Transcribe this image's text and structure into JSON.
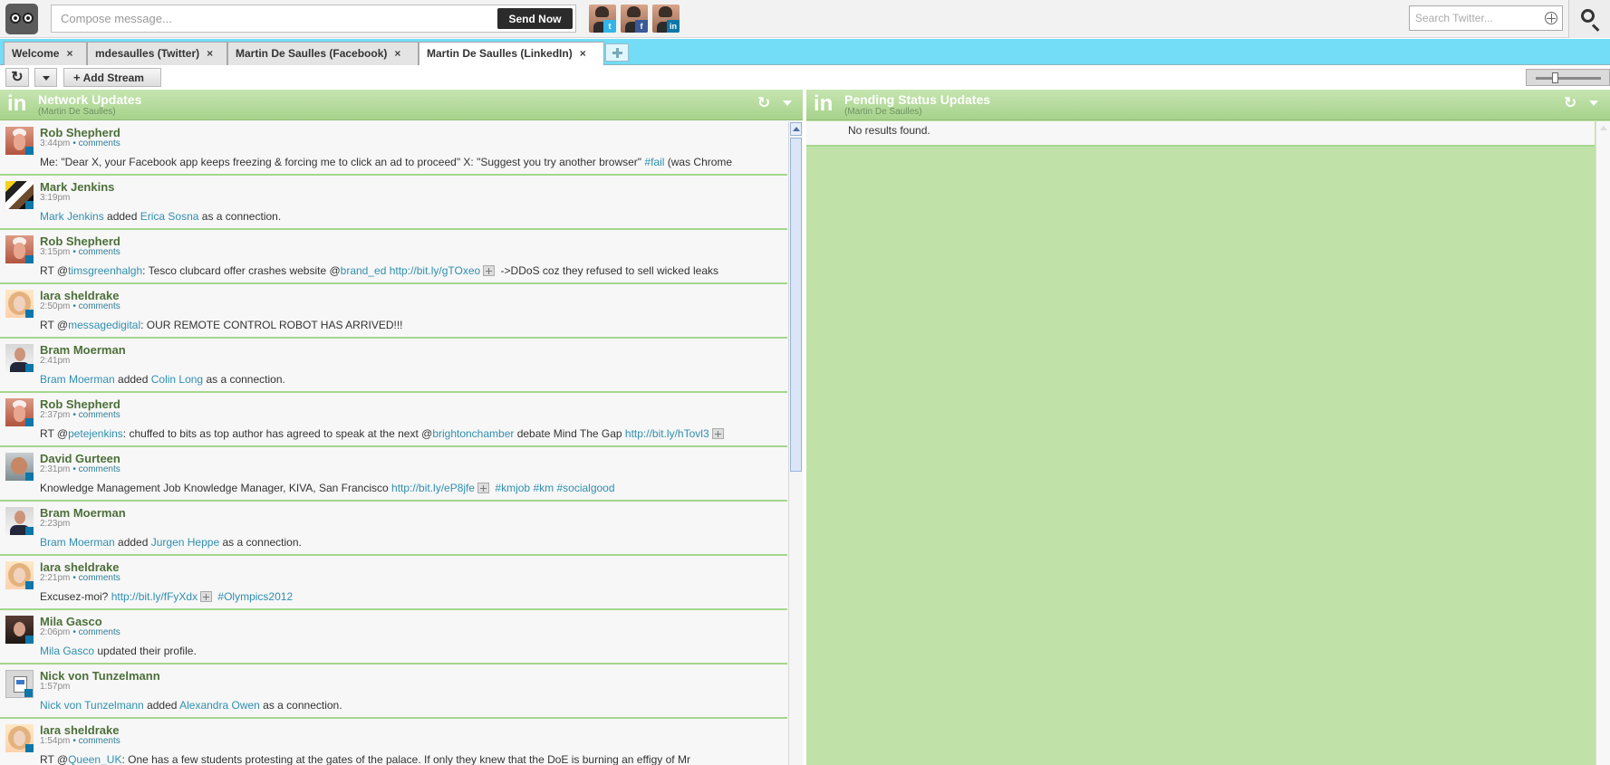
{
  "compose": {
    "placeholder": "Compose message...",
    "send_label": "Send Now"
  },
  "profiles": [
    {
      "name": "twitter-profile",
      "network": "twitter"
    },
    {
      "name": "facebook-profile",
      "network": "facebook"
    },
    {
      "name": "linkedin-profile",
      "network": "linkedin"
    }
  ],
  "search": {
    "placeholder": "Search Twitter..."
  },
  "tabs": [
    {
      "label": "Welcome",
      "close": "×"
    },
    {
      "label": "mdesaulles (Twitter)",
      "close": "×"
    },
    {
      "label": "Martin De Saulles (Facebook)",
      "close": "×"
    },
    {
      "label": "Martin De Saulles (LinkedIn)",
      "close": "×",
      "active": true
    }
  ],
  "toolbar": {
    "refresh_icon": "refresh-icon",
    "dropdown_icon": "chevron-down-icon",
    "add_stream_label": "Add Stream"
  },
  "columns": {
    "network": {
      "logo": "in",
      "title": "Network Updates",
      "subtitle": "(Martin De Saulles)",
      "posts": [
        {
          "author": "Rob Shepherd",
          "time": "3:44pm",
          "comments": "• comments",
          "text": "Me: \"Dear X, your Facebook app keeps freezing & forcing me to click an ad to proceed\" X: \"Suggest you try another browser\" #fail (was Chrome",
          "avatar": "rob"
        },
        {
          "author": "Mark Jenkins",
          "time": "3:19pm",
          "comments": "",
          "text": "Mark Jenkins added Erica Sosna as a connection.",
          "avatar": "mark"
        },
        {
          "author": "Rob Shepherd",
          "time": "3:15pm",
          "comments": "• comments",
          "text": "RT @timsgreenhalgh: Tesco clubcard offer crashes website @brand_ed http://bit.ly/gTOxeo ->DDoS coz they refused to sell wicked leaks",
          "avatar": "rob"
        },
        {
          "author": "lara sheldrake",
          "time": "2:50pm",
          "comments": "• comments",
          "text": "RT @messagedigital: OUR REMOTE CONTROL ROBOT HAS ARRIVED!!!",
          "avatar": "lara"
        },
        {
          "author": "Bram Moerman",
          "time": "2:41pm",
          "comments": "",
          "text": "Bram Moerman added Colin Long as a connection.",
          "avatar": "bram"
        },
        {
          "author": "Rob Shepherd",
          "time": "2:37pm",
          "comments": "• comments",
          "text": "RT @petejenkins: chuffed to bits as top author has agreed to speak at the next @brightonchamber debate Mind The Gap http://bit.ly/hTovl3",
          "avatar": "rob"
        },
        {
          "author": "David Gurteen",
          "time": "2:31pm",
          "comments": "• comments",
          "text": "Knowledge Management Job Knowledge Manager, KIVA, San Francisco http://bit.ly/eP8jfe #kmjob #km #socialgood",
          "avatar": "david"
        },
        {
          "author": "Bram Moerman",
          "time": "2:23pm",
          "comments": "",
          "text": "Bram Moerman added Jurgen Heppe as a connection.",
          "avatar": "bram"
        },
        {
          "author": "lara sheldrake",
          "time": "2:21pm",
          "comments": "• comments",
          "text": "Excusez-moi? http://bit.ly/fFyXdx #Olympics2012",
          "avatar": "lara"
        },
        {
          "author": "Mila Gasco",
          "time": "2:06pm",
          "comments": "• comments",
          "text": "Mila Gasco updated their profile.",
          "avatar": "mila"
        },
        {
          "author": "Nick von Tunzelmann",
          "time": "1:57pm",
          "comments": "",
          "text": "Nick von Tunzelmann added Alexandra Owen as a connection.",
          "avatar": "nick"
        },
        {
          "author": "lara sheldrake",
          "time": "1:54pm",
          "comments": "• comments",
          "text": "RT @Queen_UK: One has a few students protesting at the gates of the palace. If only they knew that the DoE is burning an effigy of Mr",
          "avatar": "lara"
        }
      ]
    },
    "pending": {
      "logo": "in",
      "title": "Pending Status Updates",
      "subtitle": "(Martin De Saulles)",
      "empty": "No results found."
    }
  },
  "colors": {
    "accent_blue": "#73dcf6",
    "linkedin_green": "#a6d28b",
    "pending_background": "#c0e2a9"
  }
}
